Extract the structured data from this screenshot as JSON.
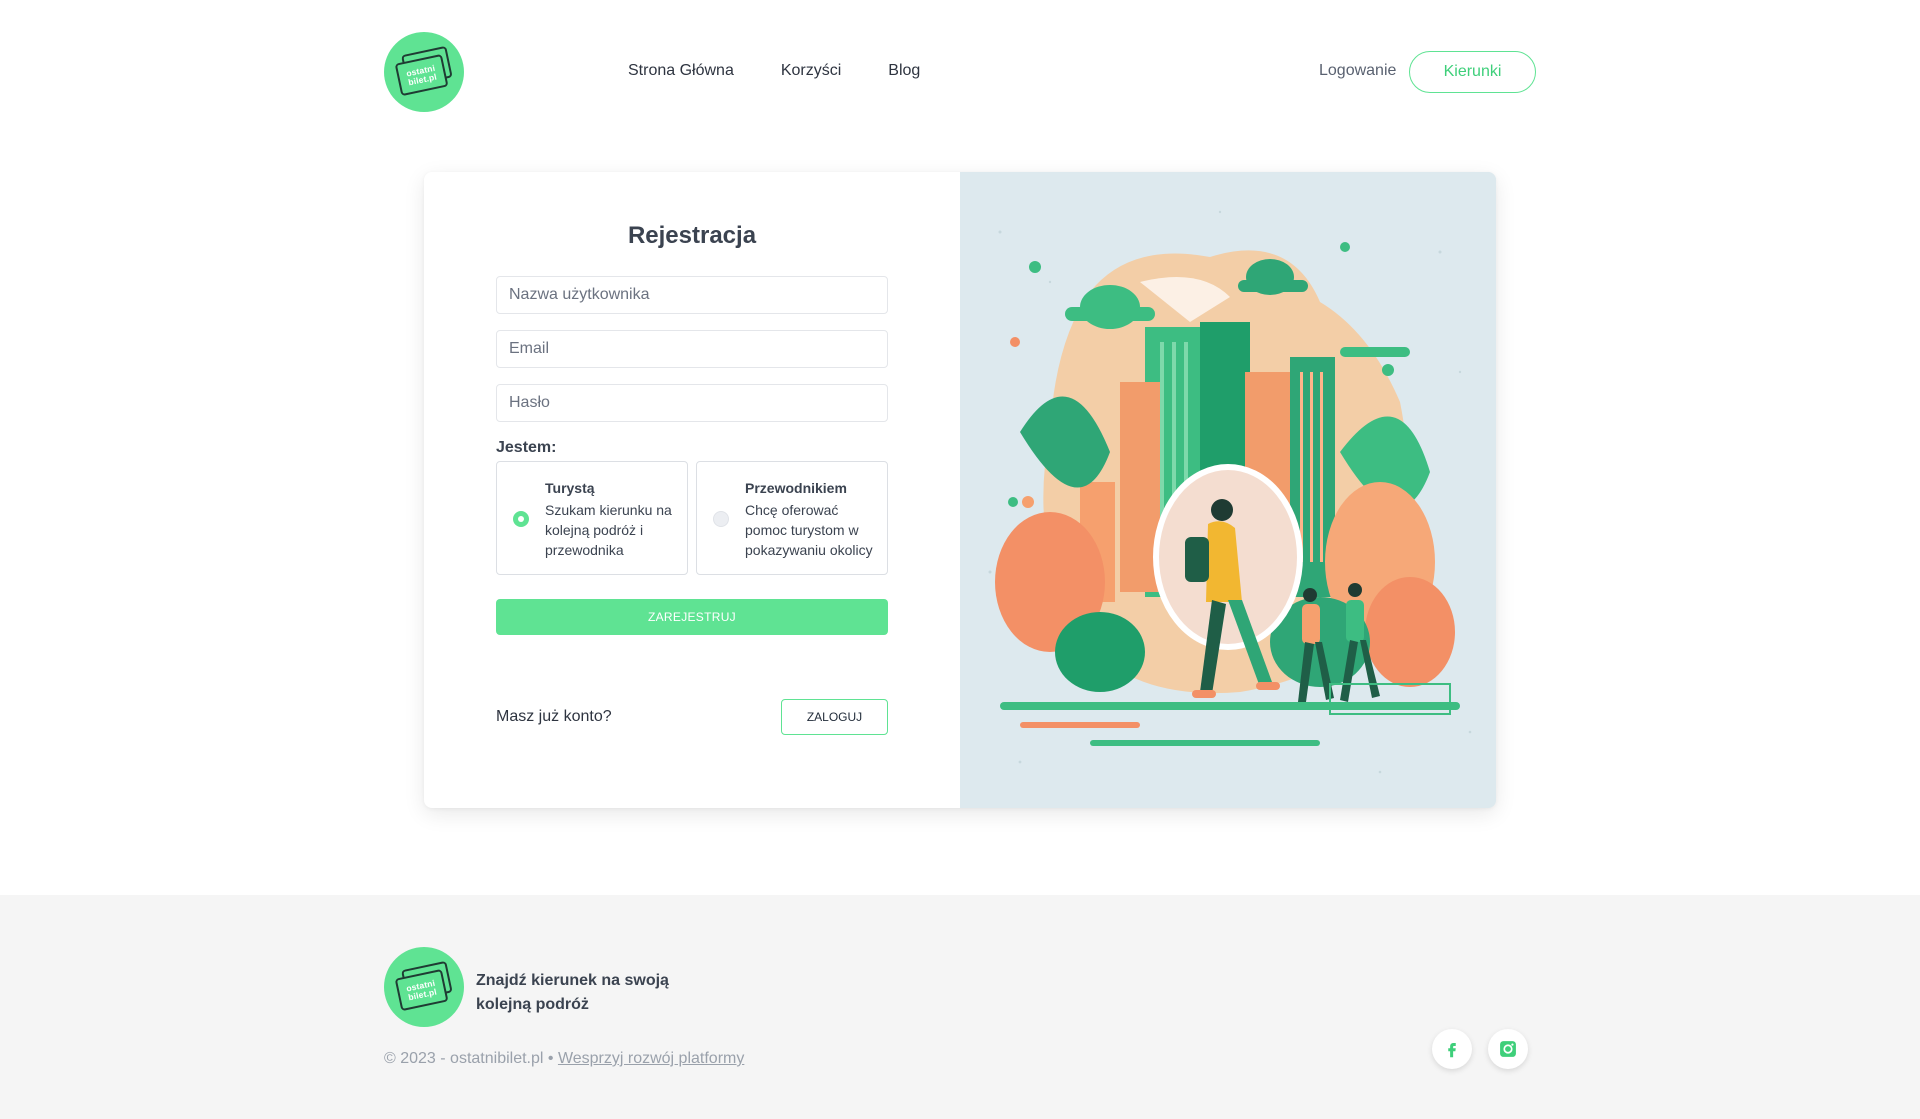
{
  "brand": {
    "logo_line1": "ostatni",
    "logo_line2": "bilet.pl"
  },
  "nav": {
    "items": [
      {
        "label": "Strona Główna"
      },
      {
        "label": "Korzyści"
      },
      {
        "label": "Blog"
      }
    ],
    "login_label": "Logowanie",
    "destinations_label": "Kierunki"
  },
  "register": {
    "title": "Rejestracja",
    "username_placeholder": "Nazwa użytkownika",
    "email_placeholder": "Email",
    "password_placeholder": "Hasło",
    "role_label": "Jestem:",
    "roles": [
      {
        "title": "Turystą",
        "description": "Szukam kierunku na kolejną podróż i przewodnika",
        "selected": true
      },
      {
        "title": "Przewodnikiem",
        "description": "Chcę oferować pomoc turystom w pokazywaniu okolicy",
        "selected": false
      }
    ],
    "submit_label": "ZAREJESTRUJ",
    "have_account_text": "Masz już konto?",
    "login_button_label": "ZALOGUJ"
  },
  "footer": {
    "tagline": "Znajdź kierunek na swoją kolejną podróż",
    "copyright": "© 2023 - ostatnibilet.pl •",
    "support_link": "Wesprzyj rozwój platformy",
    "social": [
      {
        "icon": "facebook-icon"
      },
      {
        "icon": "instagram-icon"
      }
    ]
  },
  "colors": {
    "accent": "#5fe393",
    "accent_text": "#3ecf7a",
    "footer_bg": "#f5f5f5",
    "text": "#3b4350"
  }
}
